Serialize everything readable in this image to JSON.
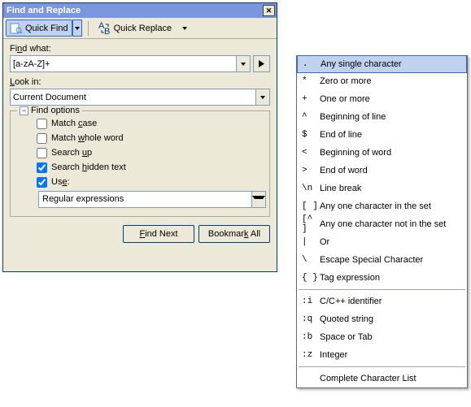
{
  "title": "Find and Replace",
  "toolbar": {
    "quick_find": "Quick Find",
    "quick_replace": "Quick Replace"
  },
  "find_what_label": "Find what:",
  "find_what_value": "[a-zA-Z]+",
  "look_in_label": "Look in:",
  "look_in_value": "Current Document",
  "options": {
    "legend": "Find options",
    "match_case": "Match case",
    "match_whole": "Match whole word",
    "search_up": "Search up",
    "search_hidden": "Search hidden text",
    "use": "Use:",
    "use_value": "Regular expressions"
  },
  "buttons": {
    "find_next": "Find Next",
    "bookmark_all": "Bookmark All"
  },
  "menu": [
    {
      "sym": ".",
      "label": "Any single character"
    },
    {
      "sym": "*",
      "label": "Zero or more"
    },
    {
      "sym": "+",
      "label": "One or more"
    },
    {
      "sym": "^",
      "label": "Beginning of line"
    },
    {
      "sym": "$",
      "label": "End of line"
    },
    {
      "sym": "<",
      "label": "Beginning of word"
    },
    {
      "sym": ">",
      "label": "End of word"
    },
    {
      "sym": "\\n",
      "label": "Line break"
    },
    {
      "sym": "[ ]",
      "label": "Any one character in the set"
    },
    {
      "sym": "[^ ]",
      "label": "Any one character not in the set"
    },
    {
      "sym": "|",
      "label": "Or"
    },
    {
      "sym": "\\",
      "label": "Escape Special Character"
    },
    {
      "sym": "{ }",
      "label": "Tag expression"
    },
    {
      "sym": ":i",
      "label": "C/C++ identifier"
    },
    {
      "sym": ":q",
      "label": "Quoted string"
    },
    {
      "sym": ":b",
      "label": "Space or Tab"
    },
    {
      "sym": ":z",
      "label": "Integer"
    }
  ],
  "menu_footer": "Complete Character List"
}
